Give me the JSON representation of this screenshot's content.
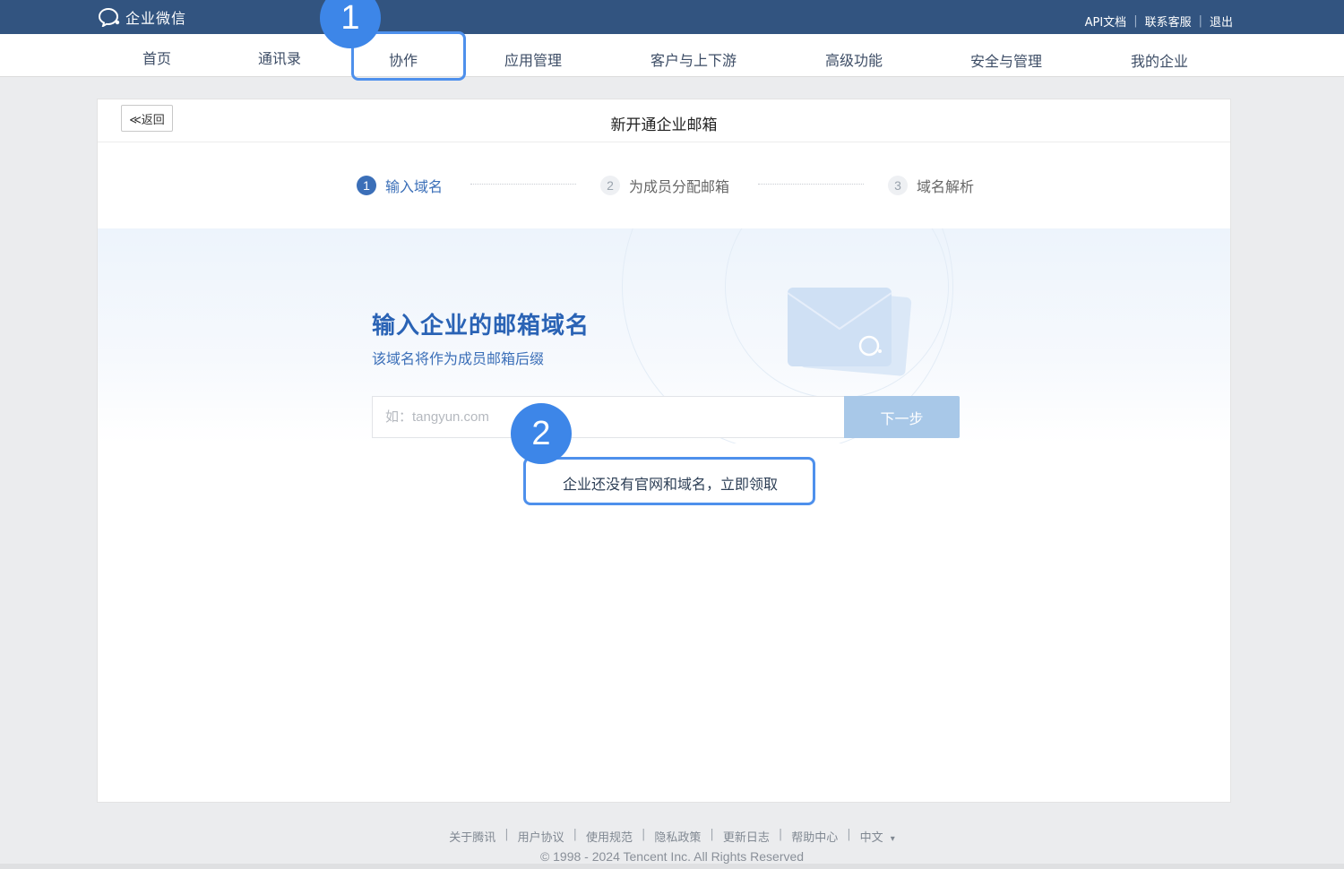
{
  "header": {
    "logo_text": "企业微信",
    "links": [
      "API文档",
      "联系客服",
      "退出"
    ]
  },
  "nav": {
    "items": [
      "首页",
      "通讯录",
      "协作",
      "应用管理",
      "客户与上下游",
      "高级功能",
      "安全与管理",
      "我的企业"
    ]
  },
  "annotations": {
    "badge_1": "1",
    "badge_2": "2"
  },
  "card": {
    "back_label": "≪返回",
    "title": "新开通企业邮箱",
    "steps": [
      {
        "num": "1",
        "label": "输入域名"
      },
      {
        "num": "2",
        "label": "为成员分配邮箱"
      },
      {
        "num": "3",
        "label": "域名解析"
      }
    ],
    "heading": "输入企业的邮箱域名",
    "subheading": "该域名将作为成员邮箱后缀",
    "input_placeholder": "如：tangyun.com",
    "next_label": "下一步",
    "get_domain_link": "企业还没有官网和域名，立即领取"
  },
  "footer": {
    "links": [
      "关于腾讯",
      "用户协议",
      "使用规范",
      "隐私政策",
      "更新日志",
      "帮助中心"
    ],
    "language": "中文",
    "language_caret": "▾",
    "copyright": "© 1998 - 2024 Tencent Inc. All Rights Reserved"
  },
  "colors": {
    "topbar": "#325480",
    "accent": "#3b6fb8",
    "highlight": "#4e90ec",
    "next_button": "#a8c8e8"
  }
}
